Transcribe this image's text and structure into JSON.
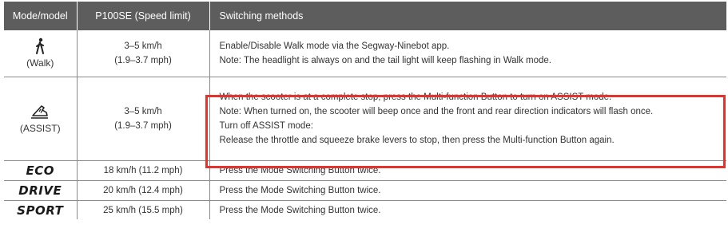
{
  "header": {
    "col1": "Mode/model",
    "col2": "P100SE (Speed limit)",
    "col3": "Switching methods"
  },
  "rows": {
    "walk": {
      "icon": "walking-person-icon",
      "mode": "(Walk)",
      "speed_line1": "3–5 km/h",
      "speed_line2": "(1.9–3.7 mph)",
      "method_lines": [
        "Enable/Disable Walk mode via the Segway-Ninebot app.",
        "Note: The headlight is always on and the tail light will keep flashing in Walk mode."
      ]
    },
    "assist": {
      "icon": "assist-shoe-icon",
      "mode": "(ASSIST)",
      "speed_line1": "3–5 km/h",
      "speed_line2": "(1.9–3.7 mph)",
      "method_lines": [
        "When the scooter is at a complete stop, press the Multi-function Button to turn on ASSIST mode.",
        "Note: When turned on, the scooter will beep once and the front and rear direction indicators will flash once.",
        "Turn off ASSIST mode:",
        "Release the throttle and squeeze brake levers to stop, then press the Multi-function Button again."
      ]
    },
    "eco": {
      "mode": "ECO",
      "speed": "18 km/h (11.2 mph)",
      "method": "Press the Mode Switching Button twice."
    },
    "drive": {
      "mode": "DRIVE",
      "speed": "20 km/h (12.4 mph)",
      "method": "Press the Mode Switching Button twice."
    },
    "sport": {
      "mode": "SPORT",
      "speed": "25 km/h (15.5 mph)",
      "method": "Press the Mode Switching Button twice."
    }
  },
  "colors": {
    "header_bg": "#5d5d5d",
    "highlight": "#e5322d"
  }
}
